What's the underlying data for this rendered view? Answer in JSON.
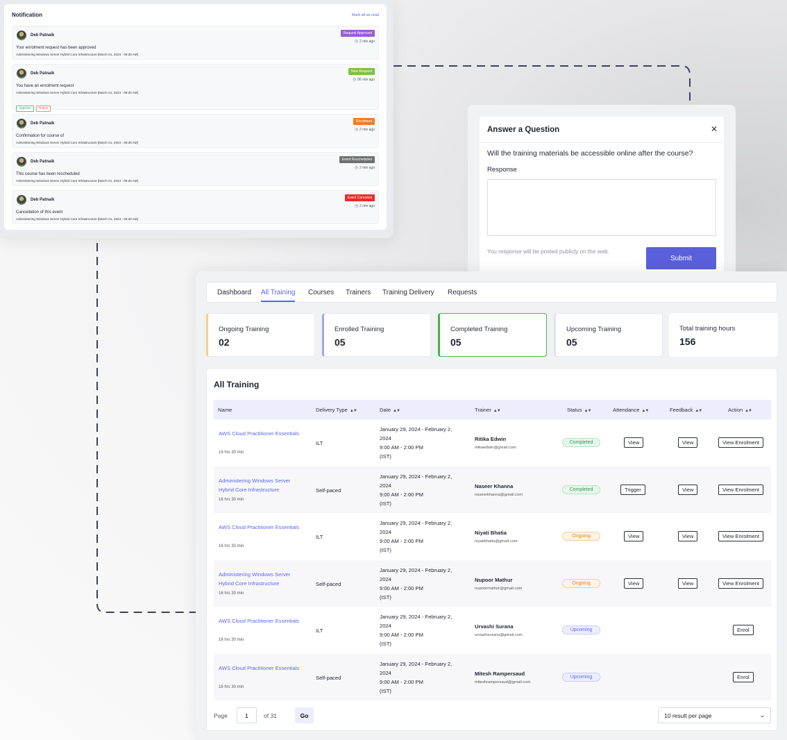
{
  "notification": {
    "title": "Notification",
    "mark_all": "Mark all as read",
    "items": [
      {
        "name": "Deb Patnaik",
        "badge": "Request Approved",
        "badge_color": "#9b5cd6",
        "time": "2 min ago",
        "message": "Your enrolment request has been approved",
        "course": "Administering Windows Server Hybrid Core Infrastructure [March 01, 2024 - 09:30 AM]"
      },
      {
        "name": "Deb Patnaik",
        "badge": "New Request",
        "badge_color": "#7cc242",
        "time": "06 min ago",
        "message": "You have an enrolment request",
        "course": "Administering Windows Server Hybrid Core Infrastructure [March 01, 2024 - 09:30 AM]",
        "approve": "Approve",
        "reject": "Reject"
      },
      {
        "name": "Deb Patnaik",
        "badge": "Enrolment",
        "badge_color": "#f07b2b",
        "time": "2 min ago",
        "message": "Confirmation for course of",
        "course": "Administering Windows Server Hybrid Core Infrastructure [March 01, 2024 - 09:30 AM]"
      },
      {
        "name": "Deb Patnaik",
        "badge": "Event Rescheduled",
        "badge_color": "#6f6f6f",
        "time": "2 min ago",
        "message": "This course has been rescheduled",
        "course": "Administering Windows Server Hybrid Core Infrastructure [March 01, 2024 - 09:30 AM]"
      },
      {
        "name": "Deb Patnaik",
        "badge": "Event Canceled",
        "badge_color": "#e82b2b",
        "time": "2 min ago",
        "message": "Cancellation of this event",
        "course": "Administering Windows Server Hybrid Core Infrastructure [March 01, 2024 - 09:30 AM]"
      }
    ]
  },
  "question_modal": {
    "title": "Answer a Question",
    "close_icon": "close-icon",
    "question": "Will the training materials be accessible online after the course?",
    "response_label": "Response",
    "response_value": "",
    "hint": "You response will be posted publicly on the web.",
    "submit": "Submit"
  },
  "nav": {
    "tabs": [
      "Dashboard",
      "All Training",
      "Courses",
      "Trainers",
      "Training Delivery",
      "Requests"
    ],
    "active": "All Training"
  },
  "stats": [
    {
      "label": "Ongoing Training",
      "value": "02",
      "accent": "#f4d08a"
    },
    {
      "label": "Enrolled Training",
      "value": "05",
      "accent": "#9ea6ef"
    },
    {
      "label": "Completed Training",
      "value": "05",
      "accent": "#4caf50"
    },
    {
      "label": "Upcoming Training",
      "value": "05",
      "accent": "#e3e4e8"
    },
    {
      "label": "Total training hours",
      "value": "156",
      "accent": "#ffffff"
    }
  ],
  "table": {
    "title": "All Training",
    "columns": [
      "Name",
      "Delivery Type",
      "Date",
      "Trainer",
      "Status",
      "Attendance",
      "Feedback",
      "Action"
    ],
    "rows": [
      {
        "name": "AWS Cloud Practitioner Essentials",
        "duration": "16 hrs 30 min",
        "delivery": "ILT",
        "date": [
          "January 29, 2024 - February 2,",
          "2024",
          "9:00 AM - 2:00 PM",
          "(IST)"
        ],
        "trainer": "Ritika Edwin",
        "email": "ritikaedwin@gmail.com",
        "status": "Completed",
        "attendance": "View",
        "feedback": "View",
        "action": "View Enrolment"
      },
      {
        "name": "Administering Windows Server Hybrid Core Infrastructure",
        "duration": "16 hrs 30 min",
        "delivery": "Self-paced",
        "date": [
          "January 29, 2024 - February 2,",
          "2024",
          "9:00 AM - 2:00 PM",
          "(IST)"
        ],
        "trainer": "Naseer Khanna",
        "email": "naseerkhanna@gmail.com",
        "status": "Completed",
        "attendance": "Trigger",
        "feedback": "View",
        "action": "View Enrolment"
      },
      {
        "name": "AWS Cloud Practitioner Essentials",
        "duration": "16 hrs 30 min",
        "delivery": "ILT",
        "date": [
          "January 29, 2024 - February 2,",
          "2024",
          "9:00 AM - 2:00 PM",
          "(IST)"
        ],
        "trainer": "Niyati Bhatia",
        "email": "niyatibhatia@gmail.com",
        "status": "Ongoing",
        "attendance": "View",
        "feedback": "View",
        "action": "View Enrolment"
      },
      {
        "name": "Administering Windows Server Hybrid Core Infrastructure",
        "duration": "16 hrs 30 min",
        "delivery": "Self-paced",
        "date": [
          "January 29, 2024 - February 2,",
          "2024",
          "9:00 AM - 2:00 PM",
          "(IST)"
        ],
        "trainer": "Nupoor Mathur",
        "email": "nupoormathur@gmail.com",
        "status": "Ongoing",
        "attendance": "View",
        "feedback": "View",
        "action": "View Enrolment"
      },
      {
        "name": "AWS Cloud Practitioner Essentials",
        "duration": "16 hrs 30 min",
        "delivery": "ILT",
        "date": [
          "January 29, 2024 - February 2,",
          "2024",
          "9:00 AM - 2:00 PM",
          "(IST)"
        ],
        "trainer": "Urvashi Surana",
        "email": "urvashisurana@gmail.com",
        "status": "Upcoming",
        "attendance": "",
        "feedback": "",
        "action": "Enrol"
      },
      {
        "name": "AWS Cloud Practitioner Essentials",
        "duration": "16 hrs 30 min",
        "delivery": "Self-paced",
        "date": [
          "January 29, 2024 - February 2,",
          "2024",
          "9:00 AM - 2:00 PM",
          "(IST)"
        ],
        "trainer": "Mitesh Rampersaud",
        "email": "miteshrampersaud@gmail.com",
        "status": "Upcoming",
        "attendance": "",
        "feedback": "",
        "action": "Enrol"
      }
    ],
    "status_colors": {
      "Completed": {
        "bg": "#e7f6ec",
        "border": "#b6e2c4",
        "text": "#2e9b55"
      },
      "Ongoing": {
        "bg": "#fdf3e6",
        "border": "#f4cf9c",
        "text": "#d58a1f"
      },
      "Upcoming": {
        "bg": "#eceefd",
        "border": "#c8cdf6",
        "text": "#5b67e8"
      }
    }
  },
  "pagination": {
    "page_label": "Page",
    "current_page": "1",
    "of_label": "of 31",
    "go": "Go",
    "per_page": "10 result per page"
  }
}
